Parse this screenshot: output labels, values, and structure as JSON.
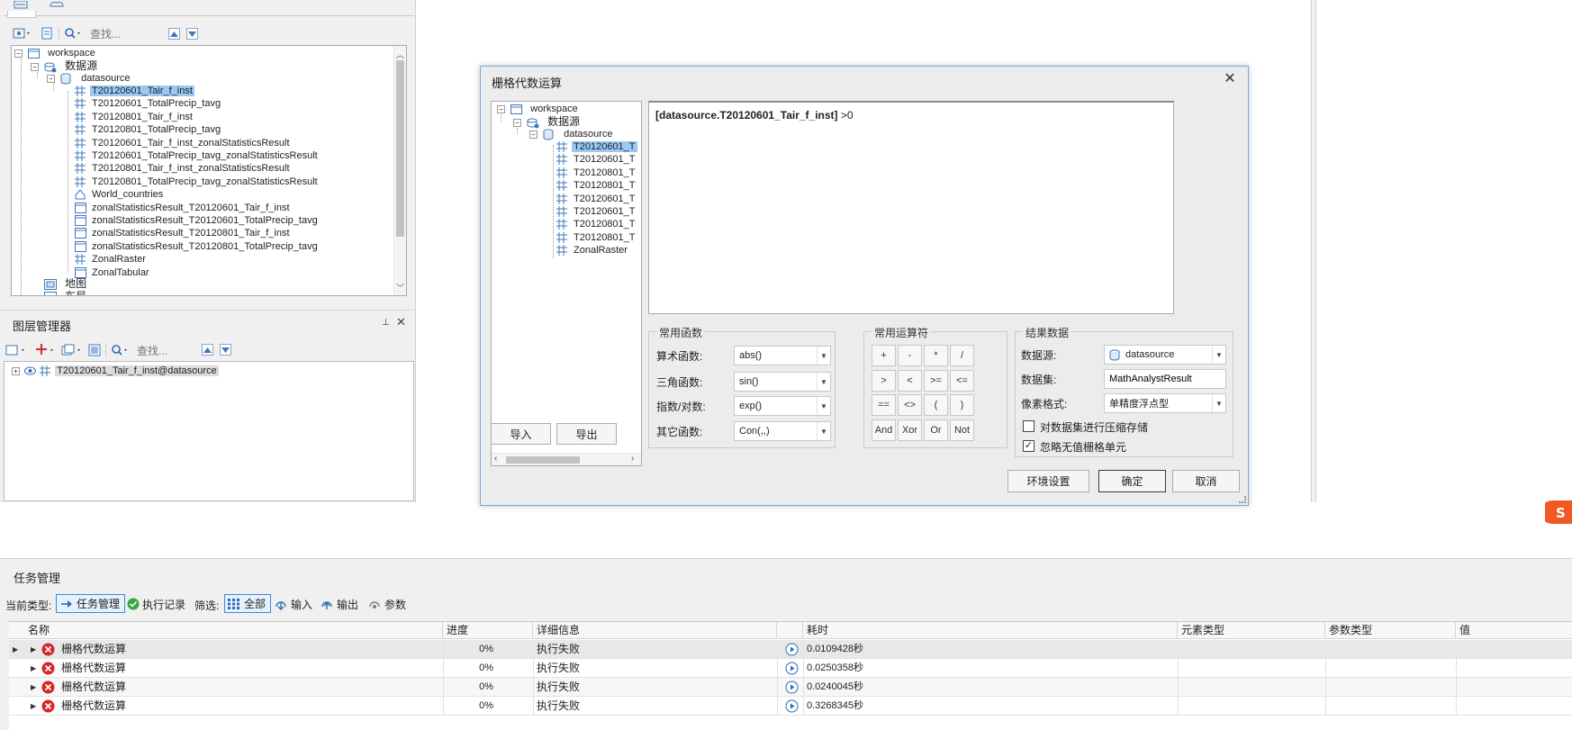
{
  "workspace_panel": {
    "search_placeholder": "查找...",
    "tree": {
      "workspace": "workspace",
      "datasource_group": "数据源",
      "datasource": "datasource",
      "datasets": [
        {
          "name": "T20120601_Tair_f_inst",
          "type": "grid",
          "selected": true
        },
        {
          "name": "T20120601_TotalPrecip_tavg",
          "type": "grid"
        },
        {
          "name": "T20120801_Tair_f_inst",
          "type": "grid"
        },
        {
          "name": "T20120801_TotalPrecip_tavg",
          "type": "grid"
        },
        {
          "name": "T20120601_Tair_f_inst_zonalStatisticsResult",
          "type": "grid"
        },
        {
          "name": "T20120601_TotalPrecip_tavg_zonalStatisticsResult",
          "type": "grid"
        },
        {
          "name": "T20120801_Tair_f_inst_zonalStatisticsResult",
          "type": "grid"
        },
        {
          "name": "T20120801_TotalPrecip_tavg_zonalStatisticsResult",
          "type": "grid"
        },
        {
          "name": "World_countries",
          "type": "region"
        },
        {
          "name": "zonalStatisticsResult_T20120601_Tair_f_inst",
          "type": "table"
        },
        {
          "name": "zonalStatisticsResult_T20120601_TotalPrecip_tavg",
          "type": "table"
        },
        {
          "name": "zonalStatisticsResult_T20120801_Tair_f_inst",
          "type": "table"
        },
        {
          "name": "zonalStatisticsResult_T20120801_TotalPrecip_tavg",
          "type": "table"
        },
        {
          "name": "ZonalRaster",
          "type": "grid"
        },
        {
          "name": "ZonalTabular",
          "type": "table"
        }
      ],
      "maps": "地图",
      "layouts": "布局"
    }
  },
  "layer_manager": {
    "title": "图层管理器",
    "search_placeholder": "查找...",
    "layer": "T20120601_Tair_f_inst@datasource"
  },
  "dialog": {
    "title": "栅格代数运算",
    "tree": {
      "workspace": "workspace",
      "datasource_group": "数据源",
      "datasource": "datasource",
      "items": [
        "T20120601_T",
        "T20120601_T",
        "T20120801_T",
        "T20120801_T",
        "T20120601_T",
        "T20120601_T",
        "T20120801_T",
        "T20120801_T",
        "ZonalRaster"
      ]
    },
    "expression_bold": "[datasource.T20120601_Tair_f_inst]",
    "expression_rest": " >0",
    "import_label": "导入",
    "export_label": "导出",
    "functions": {
      "legend": "常用函数",
      "arith_label": "算术函数:",
      "arith_value": "abs()",
      "trig_label": "三角函数:",
      "trig_value": "sin()",
      "exp_label": "指数/对数:",
      "exp_value": "exp()",
      "other_label": "其它函数:",
      "other_value": "Con(,,)"
    },
    "operators": {
      "legend": "常用运算符",
      "rows": [
        [
          "+",
          "-",
          "*",
          "/"
        ],
        [
          ">",
          "<",
          ">=",
          "<="
        ],
        [
          "==",
          "<>",
          "(",
          ")"
        ],
        [
          "And",
          "Xor",
          "Or",
          "Not"
        ]
      ]
    },
    "result": {
      "legend": "结果数据",
      "datasource_label": "数据源:",
      "datasource_value": "datasource",
      "dataset_label": "数据集:",
      "dataset_value": "MathAnalystResult",
      "pixel_label": "像素格式:",
      "pixel_value": "单精度浮点型",
      "compress_label": "对数据集进行压缩存储",
      "compress_checked": false,
      "ignore_label": "忽略无值栅格单元",
      "ignore_checked": true
    },
    "env_label": "环境设置",
    "ok_label": "确定",
    "cancel_label": "取消"
  },
  "task_manager": {
    "title": "任务管理",
    "current_type_label": "当前类型:",
    "task_mgmt": "任务管理",
    "exec_record": "执行记录",
    "filter_label": "筛选:",
    "filter_all": "全部",
    "filter_input": "输入",
    "filter_output": "输出",
    "filter_param": "参数",
    "columns": [
      "名称",
      "进度",
      "详细信息",
      "耗时",
      "元素类型",
      "参数类型",
      "值"
    ],
    "rows": [
      {
        "name": "栅格代数运算",
        "progress": "0%",
        "detail": "执行失败",
        "time": "0.0109428秒"
      },
      {
        "name": "栅格代数运算",
        "progress": "0%",
        "detail": "执行失败",
        "time": "0.0250358秒"
      },
      {
        "name": "栅格代数运算",
        "progress": "0%",
        "detail": "执行失败",
        "time": "0.0240045秒"
      },
      {
        "name": "栅格代数运算",
        "progress": "0%",
        "detail": "执行失败",
        "time": "0.3268345秒"
      }
    ]
  },
  "colors": {
    "selection": "#99c9f4",
    "error": "#d9252a",
    "accent": "#3d8ad8",
    "panel_bg": "#ececec"
  }
}
